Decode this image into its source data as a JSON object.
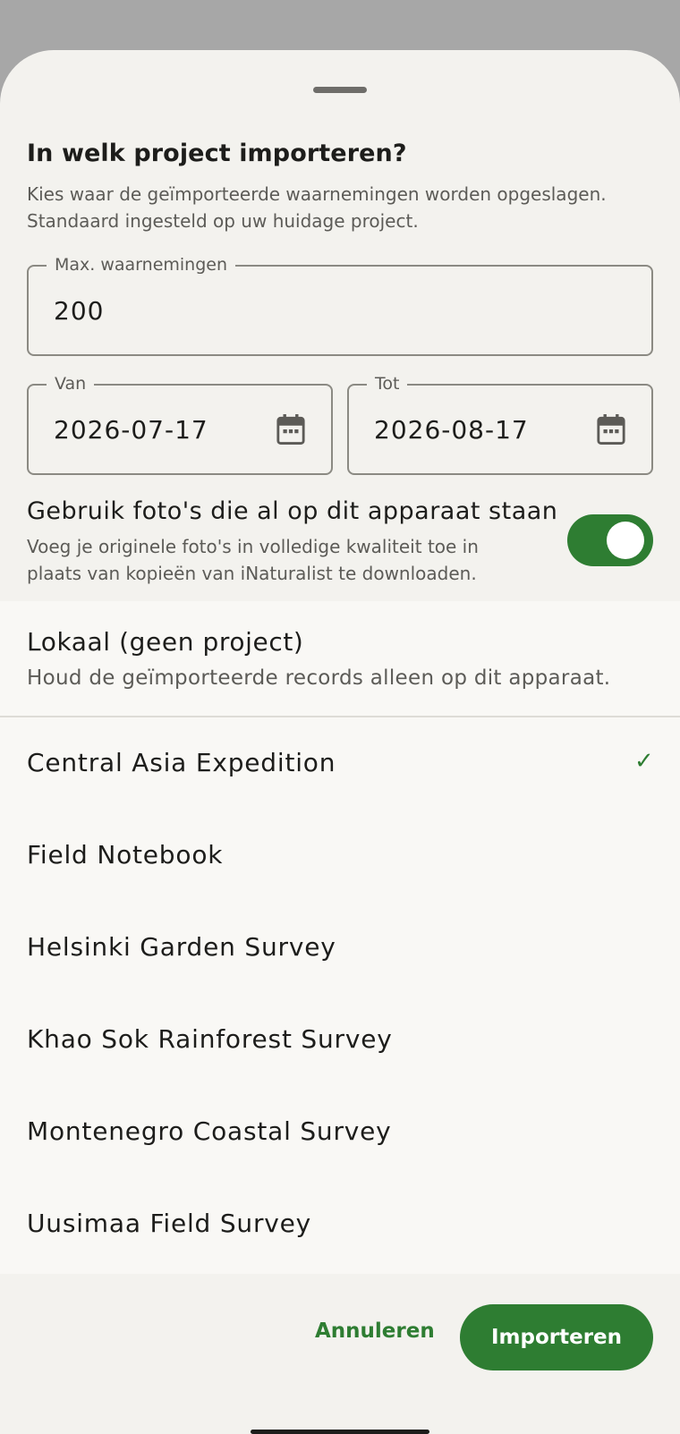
{
  "dialog": {
    "title": "In welk project importeren?",
    "subtitle": "Kies waar de geïmporteerde waarnemingen worden opgeslagen. Standaard ingesteld op uw huidage project."
  },
  "max_observations": {
    "label": "Max. waarnemingen",
    "value": "200"
  },
  "date_from": {
    "label": "Van",
    "value": "2026-07-17",
    "icon": "calendar-icon"
  },
  "date_to": {
    "label": "Tot",
    "value": "2026-08-17",
    "icon": "calendar-icon"
  },
  "local_photos": {
    "title": "Gebruik foto's die al op dit apparaat staan",
    "description": "Voeg je originele foto's in volledige kwaliteit toe in plaats van kopieën van iNaturalist te downloaden.",
    "enabled": true
  },
  "local_option": {
    "title": "Lokaal (geen project)",
    "description": "Houd de geïmporteerde records alleen op dit apparaat."
  },
  "projects": [
    {
      "name": "Central Asia Expedition",
      "selected": true,
      "check": "✓"
    },
    {
      "name": "Field Notebook",
      "selected": false
    },
    {
      "name": "Helsinki Garden Survey",
      "selected": false
    },
    {
      "name": "Khao Sok Rainforest Survey",
      "selected": false
    },
    {
      "name": "Montenegro Coastal Survey",
      "selected": false
    },
    {
      "name": "Uusimaa Field Survey",
      "selected": false
    }
  ],
  "actions": {
    "cancel": "Annuleren",
    "import": "Importeren"
  },
  "colors": {
    "accent": "#2e7d32",
    "scrim": "#a7a7a7",
    "sheet": "#f3f2ee"
  }
}
